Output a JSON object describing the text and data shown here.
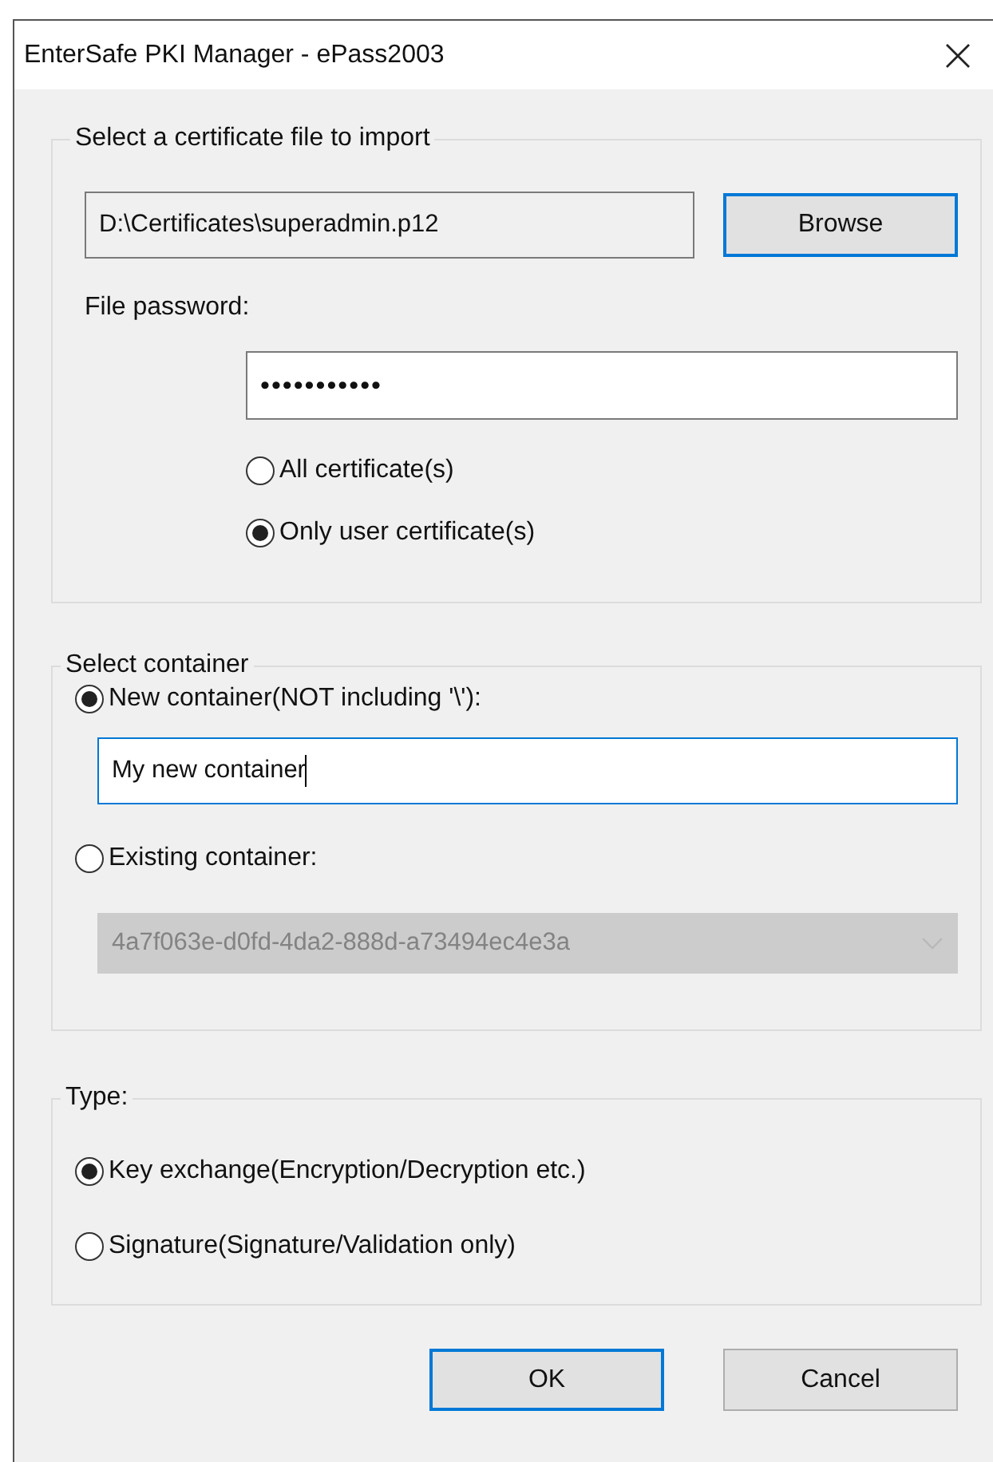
{
  "window": {
    "title": "EnterSafe PKI Manager - ePass2003"
  },
  "file_group": {
    "title": "Select a certificate file to import",
    "file_path": "D:\\Certificates\\superadmin.p12",
    "browse_button": {
      "label": "Browse",
      "focused": true
    },
    "password_label": "File password:",
    "password": "•••••••••••",
    "options": [
      {
        "label": "All certificate(s)",
        "selected": false
      },
      {
        "label": "Only user certificate(s)",
        "selected": true
      }
    ]
  },
  "container_group": {
    "title": "Select container",
    "options": [
      {
        "label": "New container(NOT including '\\'):",
        "selected": true,
        "kind": "text",
        "value": "My new container",
        "focused": true
      },
      {
        "label": "Existing container:",
        "selected": false,
        "kind": "dropdown",
        "value": "4a7f063e-d0fd-4da2-888d-a73494ec4e3a",
        "disabled": true
      }
    ]
  },
  "type_group": {
    "title": "Type:",
    "options": [
      {
        "label": "Key exchange(Encryption/Decryption etc.)",
        "selected": true
      },
      {
        "label": "Signature(Signature/Validation only)",
        "selected": false
      }
    ]
  },
  "buttons": [
    {
      "label": "OK",
      "focused": true
    },
    {
      "label": "Cancel",
      "focused": false
    }
  ]
}
